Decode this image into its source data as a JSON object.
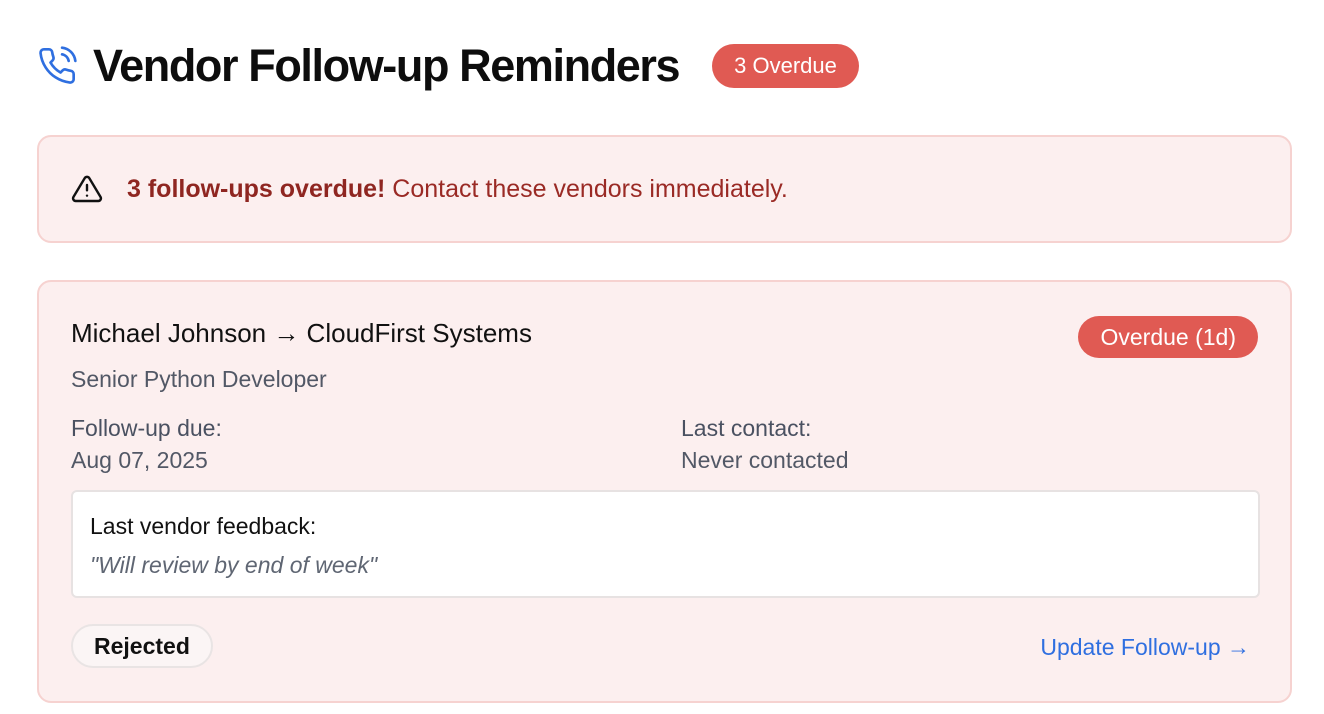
{
  "header": {
    "icon": "phone-call-icon",
    "title": "Vendor Follow-up Reminders",
    "badge": "3 Overdue"
  },
  "colors": {
    "accent_blue": "#2f6fe0",
    "danger": "#e05a53",
    "alert_bg": "#fcefef",
    "alert_text": "#9a2a25"
  },
  "alert": {
    "icon": "warning-triangle-icon",
    "strong": "3 follow-ups overdue!",
    "message": " Contact these vendors immediately."
  },
  "reminder": {
    "title": "Michael Johnson → CloudFirst Systems",
    "status_badge": "Overdue (1d)",
    "role": "Senior Python Developer",
    "due_label": "Follow-up due:",
    "due_value": "Aug 07, 2025",
    "contact_label": "Last contact:",
    "contact_value": "Never contacted",
    "feedback_label": "Last vendor feedback:",
    "feedback_quote": "\"Will review by end of week\"",
    "stage": "Rejected",
    "action": "Update Follow-up →"
  }
}
